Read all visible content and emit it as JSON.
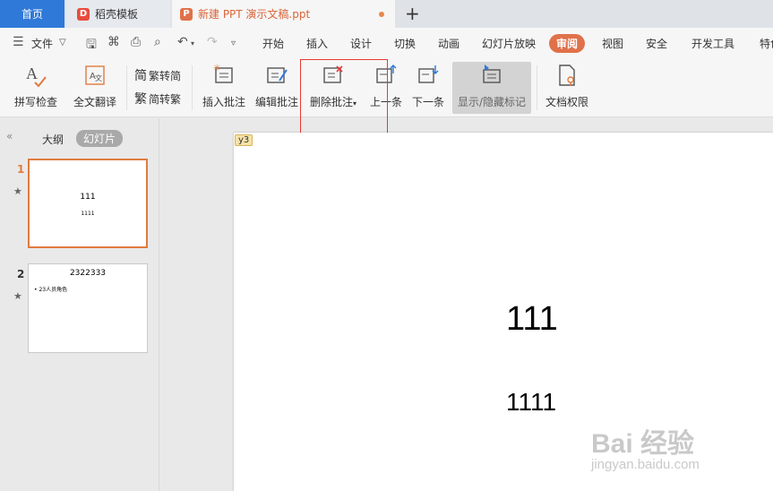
{
  "tabs": {
    "home": "首页",
    "daoke": "稻壳模板",
    "doc": "新建 PPT 演示文稿.ppt"
  },
  "menu": {
    "file": "文件",
    "items": [
      "开始",
      "插入",
      "设计",
      "切换",
      "动画",
      "幻灯片放映",
      "审阅",
      "视图",
      "安全",
      "开发工具",
      "特色"
    ],
    "active": "审阅"
  },
  "ribbon": {
    "spell_check": "拼写检查",
    "translate": "全文翻译",
    "trad_to_simp": "繁转简",
    "simp_to_trad": "简转繁",
    "insert_comment": "插入批注",
    "edit_comment": "编辑批注",
    "delete_comment": "删除批注",
    "prev": "上一条",
    "next": "下一条",
    "show_hide_marks": "显示/隐藏标记",
    "doc_permission": "文档权限"
  },
  "panel": {
    "outline": "大纲",
    "slides": "幻灯片",
    "slide_items": [
      {
        "num": "1",
        "title": "111",
        "subtitle": "1111"
      },
      {
        "num": "2",
        "title": "2322333",
        "bullet": "• 23人员角色"
      }
    ]
  },
  "slide": {
    "comment_tag": "y3",
    "title": "111",
    "subtitle": "1111"
  },
  "watermark": {
    "brand": "Bai 经验",
    "url": "jingyan.baidu.com"
  },
  "colors": {
    "accent": "#e0714a",
    "home_tab": "#2f79d9"
  }
}
